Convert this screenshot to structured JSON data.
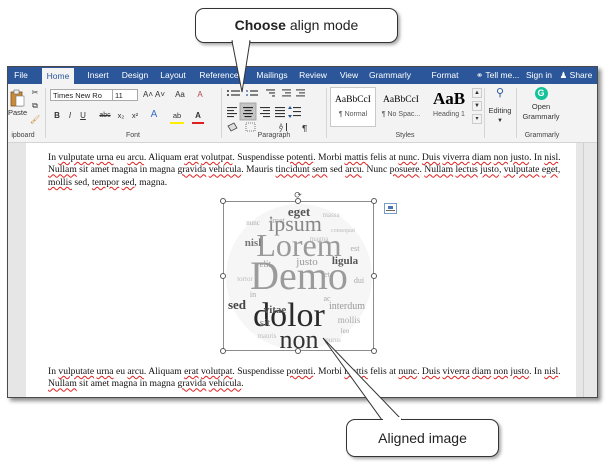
{
  "callouts": {
    "top": {
      "bold": "Choose",
      "rest": " align mode"
    },
    "bottom": "Aligned image"
  },
  "tabs": [
    {
      "label": "File"
    },
    {
      "label": "Home"
    },
    {
      "label": "Insert"
    },
    {
      "label": "Design"
    },
    {
      "label": "Layout"
    },
    {
      "label": "Reference"
    },
    {
      "label": "Mailings"
    },
    {
      "label": "Review"
    },
    {
      "label": "View"
    },
    {
      "label": "Grammarly"
    },
    {
      "label": "Format"
    }
  ],
  "tell_me": "Tell me...",
  "sign_in": "Sign in",
  "share": "Share",
  "ribbon": {
    "paste_label": "Paste",
    "clipboard_label": "ipboard",
    "font_label": "Font",
    "paragraph_label": "Paragraph",
    "styles_label": "Styles",
    "grammarly_group_label": "Grammarly",
    "font_name": "Times New Ro",
    "font_size": "11",
    "grow_font": "A˄",
    "shrink_font": "A˅",
    "change_case": "Aa",
    "clear_format": "A",
    "bold": "B",
    "italic": "I",
    "underline": "U",
    "strikethrough": "abc",
    "subscript": "x₂",
    "superscript": "x²",
    "text_effects": "A",
    "highlight": "ab",
    "font_color": "A",
    "editing_label": "Editing",
    "open_grammarly_1": "Open",
    "open_grammarly_2": "Grammarly",
    "styles": [
      {
        "preview": "AaBbCcI",
        "name": "¶ Normal"
      },
      {
        "preview": "AaBbCcI",
        "name": "¶ No Spac..."
      },
      {
        "preview": "AaB",
        "name": "Heading 1"
      }
    ]
  },
  "colors": {
    "ribbon_blue": "#2b579a",
    "grammarly_green": "#15c39a",
    "squiggle_red": "#e02020"
  },
  "para1": [
    {
      "t": "In "
    },
    {
      "t": "vulputate",
      "e": 1
    },
    {
      "t": " "
    },
    {
      "t": "urna",
      "e": 1
    },
    {
      "t": " eu "
    },
    {
      "t": "arcu",
      "e": 1
    },
    {
      "t": ". Aliquam "
    },
    {
      "t": "erat",
      "e": 1
    },
    {
      "t": " "
    },
    {
      "t": "volutpat",
      "e": 1
    },
    {
      "t": ". Suspendisse "
    },
    {
      "t": "potenti",
      "e": 1
    },
    {
      "t": ". Morbi "
    },
    {
      "t": "mattis",
      "e": 1
    },
    {
      "t": " felis at "
    },
    {
      "t": "nunc",
      "e": 1
    },
    {
      "t": ". "
    },
    {
      "t": "Duis",
      "e": 1
    },
    {
      "t": " "
    },
    {
      "t": "viverra",
      "e": 1
    },
    {
      "t": " "
    },
    {
      "t": "diam",
      "e": 1
    },
    {
      "t": " "
    },
    {
      "t": "non",
      "e": 1
    },
    {
      "t": " "
    },
    {
      "t": "justo",
      "e": 1
    },
    {
      "t": ". In "
    },
    {
      "t": "nisl",
      "e": 1
    },
    {
      "t": ". "
    },
    {
      "t": "Nullam",
      "e": 1
    },
    {
      "t": " sit amet magna in magna "
    },
    {
      "t": "gravida",
      "e": 1
    },
    {
      "t": " "
    },
    {
      "t": "vehicula",
      "e": 1
    },
    {
      "t": ". Mauris "
    },
    {
      "t": "tincidunt",
      "e": 1
    },
    {
      "t": " "
    },
    {
      "t": "sem",
      "e": 1
    },
    {
      "t": " sed "
    },
    {
      "t": "arcu",
      "e": 1
    },
    {
      "t": ". Nunc "
    },
    {
      "t": "posuere",
      "e": 1
    },
    {
      "t": ". "
    },
    {
      "t": "Nullam",
      "e": 1
    },
    {
      "t": " "
    },
    {
      "t": "lectus",
      "e": 1
    },
    {
      "t": " "
    },
    {
      "t": "justo",
      "e": 1
    },
    {
      "t": ", "
    },
    {
      "t": "vulputate",
      "e": 1
    },
    {
      "t": " "
    },
    {
      "t": "eget",
      "e": 1
    },
    {
      "t": ", "
    },
    {
      "t": "mollis",
      "e": 1
    },
    {
      "t": " sed, "
    },
    {
      "t": "tempor",
      "e": 1
    },
    {
      "t": " "
    },
    {
      "t": "sed",
      "e": 1
    },
    {
      "t": ", magna."
    }
  ],
  "para2": [
    {
      "t": "In "
    },
    {
      "t": "vulputate",
      "e": 1
    },
    {
      "t": " "
    },
    {
      "t": "urna",
      "e": 1
    },
    {
      "t": " eu "
    },
    {
      "t": "arcu",
      "e": 1
    },
    {
      "t": ". Aliquam "
    },
    {
      "t": "erat",
      "e": 1
    },
    {
      "t": " "
    },
    {
      "t": "volutpat",
      "e": 1
    },
    {
      "t": ". Suspendisse "
    },
    {
      "t": "potenti",
      "e": 1
    },
    {
      "t": ". Morbi "
    },
    {
      "t": "mattis",
      "e": 1
    },
    {
      "t": " felis at "
    },
    {
      "t": "nunc",
      "e": 1
    },
    {
      "t": ". "
    },
    {
      "t": "Duis",
      "e": 1
    },
    {
      "t": " "
    },
    {
      "t": "viverra",
      "e": 1
    },
    {
      "t": " "
    },
    {
      "t": "diam",
      "e": 1
    },
    {
      "t": " "
    },
    {
      "t": "non",
      "e": 1
    },
    {
      "t": " "
    },
    {
      "t": "justo",
      "e": 1
    },
    {
      "t": ". In "
    },
    {
      "t": "nisl",
      "e": 1
    },
    {
      "t": ". "
    },
    {
      "t": "Nullam",
      "e": 1
    },
    {
      "t": " sit amet magna in magna "
    },
    {
      "t": "gravida",
      "e": 1
    },
    {
      "t": " "
    },
    {
      "t": "vehicula",
      "e": 1
    },
    {
      "t": "."
    }
  ],
  "word_cloud": [
    {
      "w": "eget",
      "c": "#555"
    },
    {
      "w": "ipsum",
      "c": "#888"
    },
    {
      "w": "Lorem",
      "c": "#9a9a9a"
    },
    {
      "w": "Demo",
      "c": "#9b9b9b"
    },
    {
      "w": "dolor",
      "c": "#2a2a2a"
    },
    {
      "w": "non",
      "c": "#333"
    },
    {
      "w": "nisl",
      "c": "#777"
    },
    {
      "w": "justo",
      "c": "#999"
    },
    {
      "w": "ligula",
      "c": "#555"
    },
    {
      "w": "sed",
      "c": "#444"
    },
    {
      "w": "vitae",
      "c": "#555"
    },
    {
      "w": "interdum",
      "c": "#999"
    },
    {
      "w": "sit",
      "c": "#777"
    },
    {
      "w": "velit",
      "c": "#999"
    },
    {
      "w": "mollis",
      "c": "#aaa"
    },
    {
      "w": "dui",
      "c": "#aaa"
    },
    {
      "w": "est",
      "c": "#aaa"
    },
    {
      "w": "massa",
      "c": "#bbb"
    },
    {
      "w": "consequat",
      "c": "#bbb"
    },
    {
      "w": "leo",
      "c": "#aaa"
    },
    {
      "w": "mauris",
      "c": "#bbb"
    },
    {
      "w": "nunc",
      "c": "#aaa"
    },
    {
      "w": "purus",
      "c": "#bbb"
    },
    {
      "w": "tortor",
      "c": "#bbb"
    },
    {
      "w": "magna",
      "c": "#bbb"
    },
    {
      "w": "amet",
      "c": "#aaa"
    },
    {
      "w": "ac",
      "c": "#aaa"
    },
    {
      "w": "in",
      "c": "#aaa"
    },
    {
      "w": "et",
      "c": "#aaa"
    }
  ]
}
